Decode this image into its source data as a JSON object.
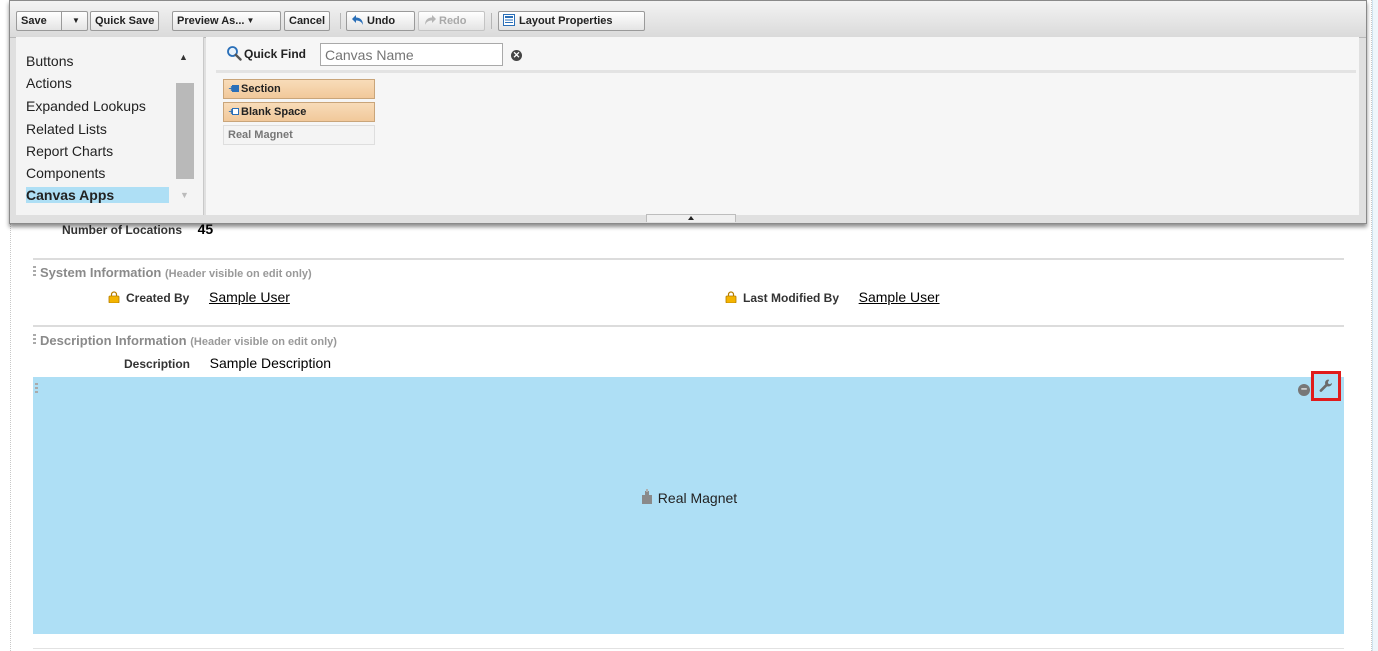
{
  "toolbar": {
    "save_label": "Save",
    "quick_save_label": "Quick Save",
    "preview_label": "Preview As...",
    "cancel_label": "Cancel",
    "undo_label": "Undo",
    "redo_label": "Redo",
    "layout_properties_label": "Layout Properties"
  },
  "sidebar": {
    "items": [
      {
        "label": "Buttons"
      },
      {
        "label": "Actions"
      },
      {
        "label": "Expanded Lookups"
      },
      {
        "label": "Related Lists"
      },
      {
        "label": "Report Charts"
      },
      {
        "label": "Components"
      },
      {
        "label": "Canvas Apps",
        "selected": true
      }
    ]
  },
  "quick_find": {
    "label": "Quick Find",
    "placeholder": "Canvas Name"
  },
  "palette_items": [
    {
      "label": "Section"
    },
    {
      "label": "Blank Space"
    },
    {
      "label": "Real Magnet"
    }
  ],
  "layout": {
    "partial_field": {
      "label": "Number of Locations",
      "value": "45"
    },
    "system_section": {
      "title": "System Information",
      "note": "(Header visible on edit only)",
      "created_by_label": "Created By",
      "created_by_value": "Sample User",
      "modified_by_label": "Last Modified By",
      "modified_by_value": "Sample User"
    },
    "description_section": {
      "title": "Description Information",
      "note": "(Header visible on edit only)",
      "description_label": "Description",
      "description_value": "Sample Description"
    },
    "canvas_block": {
      "label": "Real Magnet",
      "background": "#aedff5",
      "highlight_color": "#e01c1c"
    }
  },
  "icons": {
    "undo": "undo-icon",
    "redo": "redo-icon",
    "layout": "layout-properties-icon",
    "search": "search-icon",
    "lock": "lock-icon",
    "wrench": "wrench-icon",
    "remove": "minus-icon",
    "canvas": "canvas-app-icon"
  }
}
